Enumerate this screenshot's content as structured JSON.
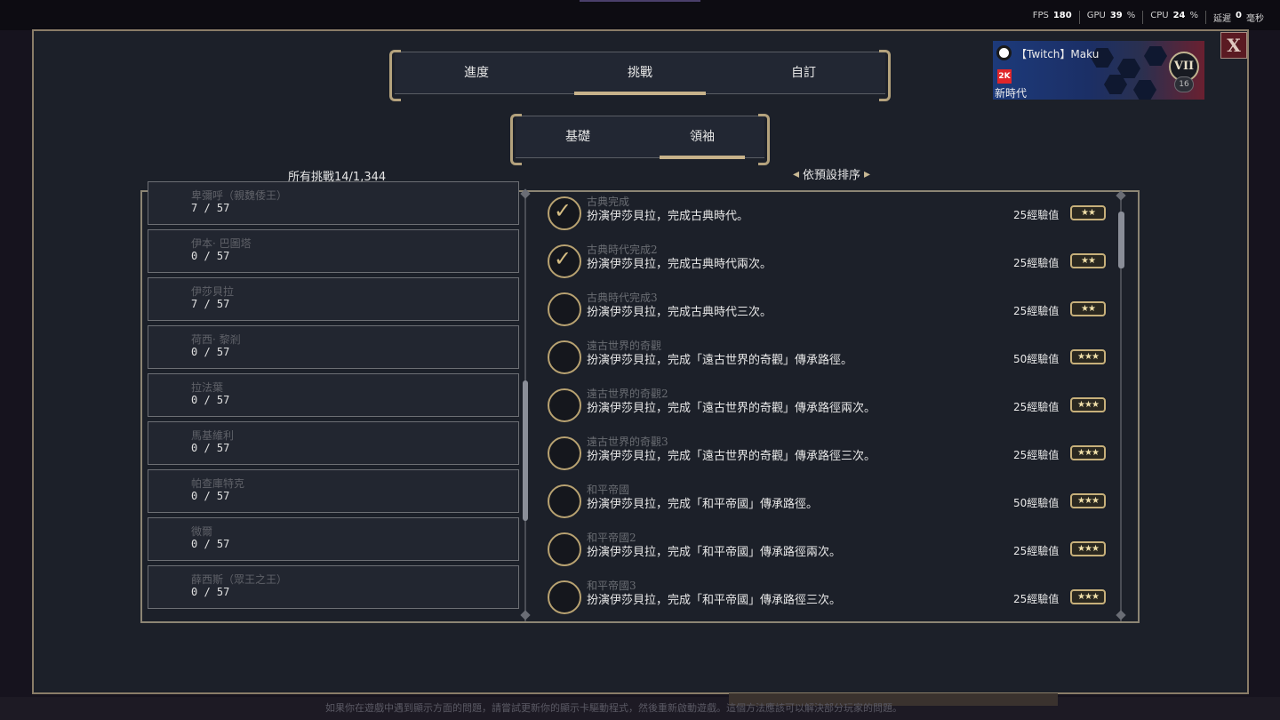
{
  "perf": {
    "fps_label": "FPS",
    "fps_value": "180",
    "gpu_label": "GPU",
    "gpu_value": "39",
    "cpu_label": "CPU",
    "cpu_value": "24",
    "latency_label": "延遲",
    "latency_value": "0"
  },
  "close_label": "X",
  "main_tabs": [
    "進度",
    "挑戰",
    "自訂"
  ],
  "main_active": 1,
  "sub_tabs": [
    "基礎",
    "領袖"
  ],
  "sub_active": 1,
  "count_label": "所有挑戰14/1,344",
  "sort_label": "依預設排序",
  "profile": {
    "name": "【Twitch】Maku",
    "era": "新時代",
    "level_numeral": "VII",
    "level_number": "16",
    "badge": "2K"
  },
  "leaders": [
    {
      "name": "卑彌呼（親魏倭王）",
      "progress": "7 / 57"
    },
    {
      "name": "伊本· 巴圖塔",
      "progress": "0 / 57"
    },
    {
      "name": "伊莎貝拉",
      "progress": "7 / 57"
    },
    {
      "name": "荷西· 黎剎",
      "progress": "0 / 57"
    },
    {
      "name": "拉法葉",
      "progress": "0 / 57"
    },
    {
      "name": "馬基維利",
      "progress": "0 / 57"
    },
    {
      "name": "帕查庫特克",
      "progress": "0 / 57"
    },
    {
      "name": "微爾",
      "progress": "0 / 57"
    },
    {
      "name": "薛西斯（眾王之王）",
      "progress": "0 / 57"
    }
  ],
  "challenges": [
    {
      "title": "古典完成",
      "desc": "扮演伊莎貝拉，完成古典時代。",
      "xp": "25經驗值",
      "stars": "★★",
      "done": true
    },
    {
      "title": "古典時代完成2",
      "desc": "扮演伊莎貝拉，完成古典時代兩次。",
      "xp": "25經驗值",
      "stars": "★★",
      "done": true
    },
    {
      "title": "古典時代完成3",
      "desc": "扮演伊莎貝拉，完成古典時代三次。",
      "xp": "25經驗值",
      "stars": "★★",
      "done": false
    },
    {
      "title": "遠古世界的奇觀",
      "desc": "扮演伊莎貝拉，完成「遠古世界的奇觀」傳承路徑。",
      "xp": "50經驗值",
      "stars": "★★★",
      "done": false
    },
    {
      "title": "遠古世界的奇觀2",
      "desc": "扮演伊莎貝拉，完成「遠古世界的奇觀」傳承路徑兩次。",
      "xp": "25經驗值",
      "stars": "★★★",
      "done": false
    },
    {
      "title": "遠古世界的奇觀3",
      "desc": "扮演伊莎貝拉，完成「遠古世界的奇觀」傳承路徑三次。",
      "xp": "25經驗值",
      "stars": "★★★",
      "done": false
    },
    {
      "title": "和平帝國",
      "desc": "扮演伊莎貝拉，完成「和平帝國」傳承路徑。",
      "xp": "50經驗值",
      "stars": "★★★",
      "done": false
    },
    {
      "title": "和平帝國2",
      "desc": "扮演伊莎貝拉，完成「和平帝國」傳承路徑兩次。",
      "xp": "25經驗值",
      "stars": "★★★",
      "done": false
    },
    {
      "title": "和平帝國3",
      "desc": "扮演伊莎貝拉，完成「和平帝國」傳承路徑三次。",
      "xp": "25經驗值",
      "stars": "★★★",
      "done": false
    }
  ],
  "footer_text": "如果你在遊戲中遇到顯示方面的問題，請嘗試更新你的顯示卡驅動程式，然後重新啟動遊戲。這個方法應該可以解決部分玩家的問題。",
  "colors": {
    "accent_gold": "#c7b28a",
    "panel_bg": "#1c2029",
    "close_bg": "#5a1a22"
  }
}
